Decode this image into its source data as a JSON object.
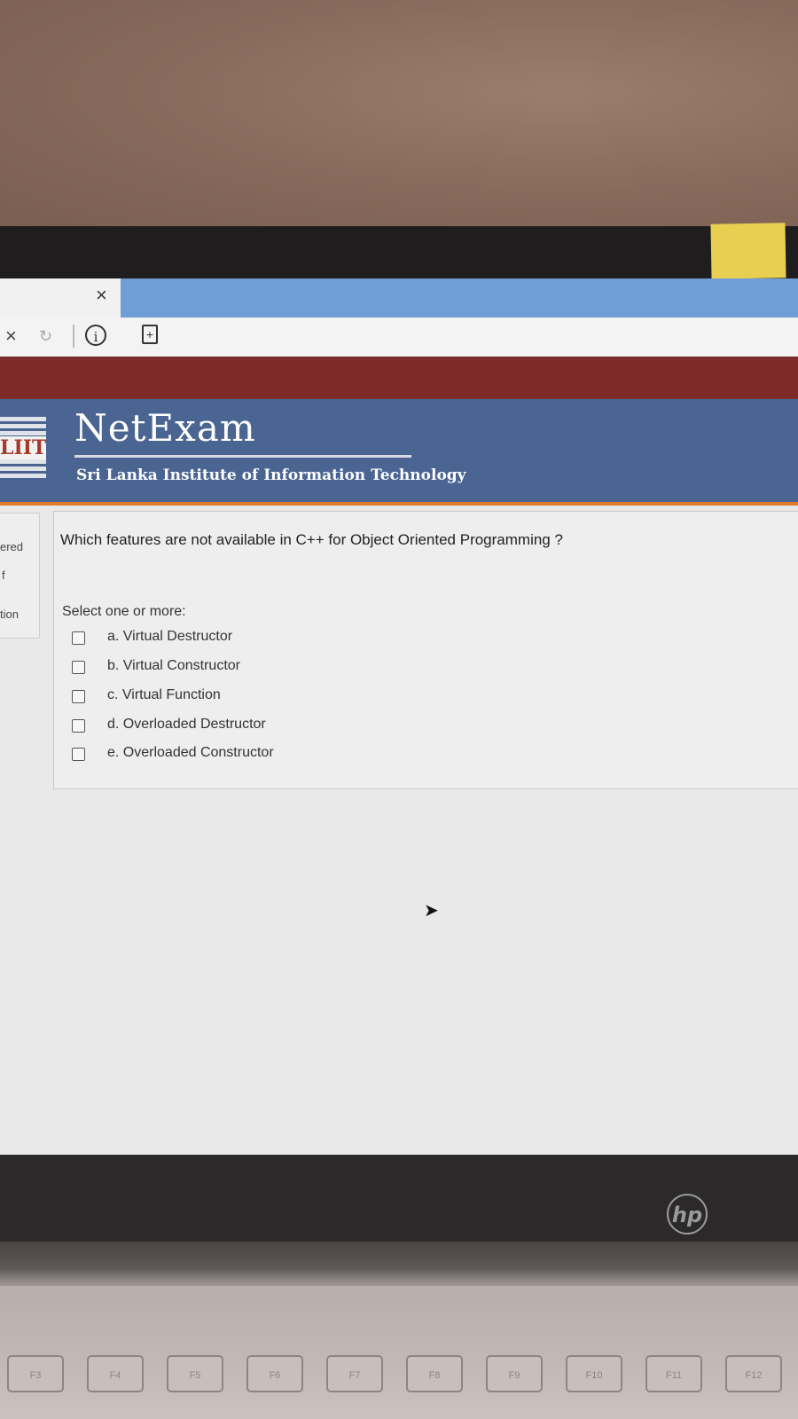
{
  "browser": {
    "tab_close_glyph": "×",
    "nav_stop_glyph": "×",
    "nav_reload_glyph": "↻",
    "info_glyph": "i",
    "doc_glyph": "+"
  },
  "site": {
    "logo_text": "LIIT",
    "title": "NetExam",
    "subtitle": "Sri Lanka Institute of Information Technology",
    "colors": {
      "red_bar": "#7e2a2a",
      "header_blue": "#4b6593",
      "accent_orange": "#e07a2c"
    }
  },
  "leftnav": {
    "fragments": [
      "ered",
      "f",
      "tion"
    ]
  },
  "question": {
    "text": "Which features are not available in C++ for Object Oriented Programming ?",
    "prompt": "Select one or more:",
    "options": [
      {
        "label": "a. Virtual Destructor",
        "checked": false
      },
      {
        "label": "b. Virtual Constructor",
        "checked": false
      },
      {
        "label": "c. Virtual Function",
        "checked": false
      },
      {
        "label": "d. Overloaded Destructor",
        "checked": false
      },
      {
        "label": "e. Overloaded Constructor",
        "checked": false
      }
    ]
  },
  "laptop": {
    "brand": "hp",
    "keys": [
      "F3",
      "F4",
      "F5",
      "F6",
      "F7",
      "F8",
      "F9",
      "F10",
      "F11",
      "F12"
    ]
  }
}
